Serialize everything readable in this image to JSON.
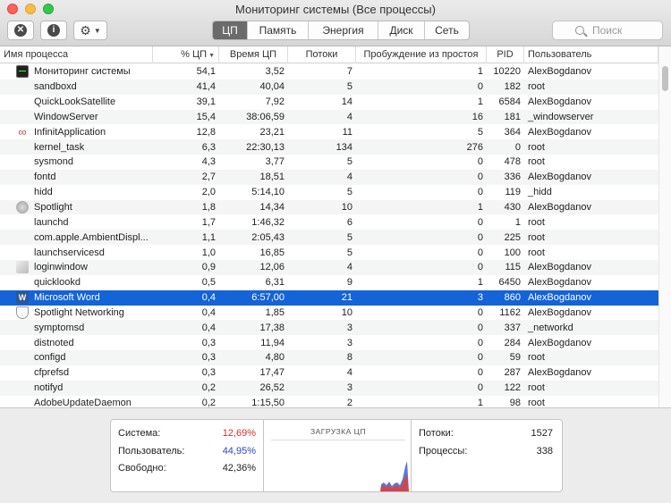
{
  "window": {
    "title": "Мониторинг системы (Все процессы)"
  },
  "toolbar": {
    "tabs": [
      {
        "label": "ЦП",
        "active": true
      },
      {
        "label": "Память",
        "active": false
      },
      {
        "label": "Энергия",
        "active": false
      },
      {
        "label": "Диск",
        "active": false
      },
      {
        "label": "Сеть",
        "active": false
      }
    ],
    "search_placeholder": "Поиск",
    "icons": {
      "stop": "close-circle-icon",
      "info": "info-icon",
      "gear": "gear-icon"
    }
  },
  "table": {
    "columns": [
      "Имя процесса",
      "% ЦП",
      "Время ЦП",
      "Потоки",
      "Пробуждение из простоя",
      "PID",
      "Пользователь"
    ],
    "sorted_column": "% ЦП",
    "rows": [
      {
        "icon": "activity-monitor-icon",
        "name": "Мониторинг системы",
        "cpu": "54,1",
        "time": "3,52",
        "threads": "7",
        "wakeups": "1",
        "pid": "10220",
        "user": "AlexBogdanov"
      },
      {
        "icon": "",
        "name": "sandboxd",
        "cpu": "41,4",
        "time": "40,04",
        "threads": "5",
        "wakeups": "0",
        "pid": "182",
        "user": "root"
      },
      {
        "icon": "",
        "name": "QuickLookSatellite",
        "cpu": "39,1",
        "time": "7,92",
        "threads": "14",
        "wakeups": "1",
        "pid": "6584",
        "user": "AlexBogdanov"
      },
      {
        "icon": "",
        "name": "WindowServer",
        "cpu": "15,4",
        "time": "38:06,59",
        "threads": "4",
        "wakeups": "16",
        "pid": "181",
        "user": "_windowserver"
      },
      {
        "icon": "infinit-icon",
        "name": "InfinitApplication",
        "cpu": "12,8",
        "time": "23,21",
        "threads": "11",
        "wakeups": "5",
        "pid": "364",
        "user": "AlexBogdanov"
      },
      {
        "icon": "",
        "name": "kernel_task",
        "cpu": "6,3",
        "time": "22:30,13",
        "threads": "134",
        "wakeups": "276",
        "pid": "0",
        "user": "root"
      },
      {
        "icon": "",
        "name": "sysmond",
        "cpu": "4,3",
        "time": "3,77",
        "threads": "5",
        "wakeups": "0",
        "pid": "478",
        "user": "root"
      },
      {
        "icon": "",
        "name": "fontd",
        "cpu": "2,7",
        "time": "18,51",
        "threads": "4",
        "wakeups": "0",
        "pid": "336",
        "user": "AlexBogdanov"
      },
      {
        "icon": "",
        "name": "hidd",
        "cpu": "2,0",
        "time": "5:14,10",
        "threads": "5",
        "wakeups": "0",
        "pid": "119",
        "user": "_hidd"
      },
      {
        "icon": "spotlight-icon",
        "name": "Spotlight",
        "cpu": "1,8",
        "time": "14,34",
        "threads": "10",
        "wakeups": "1",
        "pid": "430",
        "user": "AlexBogdanov"
      },
      {
        "icon": "",
        "name": "launchd",
        "cpu": "1,7",
        "time": "1:46,32",
        "threads": "6",
        "wakeups": "0",
        "pid": "1",
        "user": "root"
      },
      {
        "icon": "",
        "name": "com.apple.AmbientDispl...",
        "cpu": "1,1",
        "time": "2:05,43",
        "threads": "5",
        "wakeups": "0",
        "pid": "225",
        "user": "root"
      },
      {
        "icon": "",
        "name": "launchservicesd",
        "cpu": "1,0",
        "time": "16,85",
        "threads": "5",
        "wakeups": "0",
        "pid": "100",
        "user": "root"
      },
      {
        "icon": "loginwindow-icon",
        "name": "loginwindow",
        "cpu": "0,9",
        "time": "12,06",
        "threads": "4",
        "wakeups": "0",
        "pid": "115",
        "user": "AlexBogdanov"
      },
      {
        "icon": "",
        "name": "quicklookd",
        "cpu": "0,5",
        "time": "6,31",
        "threads": "9",
        "wakeups": "1",
        "pid": "6450",
        "user": "AlexBogdanov"
      },
      {
        "icon": "word-icon",
        "name": "Microsoft Word",
        "cpu": "0,4",
        "time": "6:57,00",
        "threads": "21",
        "wakeups": "3",
        "pid": "860",
        "user": "AlexBogdanov",
        "selected": true
      },
      {
        "icon": "shield-icon",
        "name": "Spotlight Networking",
        "cpu": "0,4",
        "time": "1,85",
        "threads": "10",
        "wakeups": "0",
        "pid": "1162",
        "user": "AlexBogdanov"
      },
      {
        "icon": "",
        "name": "symptomsd",
        "cpu": "0,4",
        "time": "17,38",
        "threads": "3",
        "wakeups": "0",
        "pid": "337",
        "user": "_networkd"
      },
      {
        "icon": "",
        "name": "distnoted",
        "cpu": "0,3",
        "time": "11,94",
        "threads": "3",
        "wakeups": "0",
        "pid": "284",
        "user": "AlexBogdanov"
      },
      {
        "icon": "",
        "name": "configd",
        "cpu": "0,3",
        "time": "4,80",
        "threads": "8",
        "wakeups": "0",
        "pid": "59",
        "user": "root"
      },
      {
        "icon": "",
        "name": "cfprefsd",
        "cpu": "0,3",
        "time": "17,47",
        "threads": "4",
        "wakeups": "0",
        "pid": "287",
        "user": "AlexBogdanov"
      },
      {
        "icon": "",
        "name": "notifyd",
        "cpu": "0,2",
        "time": "26,52",
        "threads": "3",
        "wakeups": "0",
        "pid": "122",
        "user": "root"
      },
      {
        "icon": "",
        "name": "AdobeUpdateDaemon",
        "cpu": "0,2",
        "time": "1:15,50",
        "threads": "2",
        "wakeups": "1",
        "pid": "98",
        "user": "root"
      }
    ]
  },
  "summary": {
    "system_label": "Система:",
    "system_value": "12,69%",
    "user_label": "Пользователь:",
    "user_value": "44,95%",
    "idle_label": "Свободно:",
    "idle_value": "42,36%",
    "graph_title": "ЗАГРУЗКА ЦП",
    "threads_label": "Потоки:",
    "threads_value": "1527",
    "processes_label": "Процессы:",
    "processes_value": "338"
  },
  "colors": {
    "system": "#d0302a",
    "user": "#2b47c8",
    "selection": "#1463d7"
  }
}
